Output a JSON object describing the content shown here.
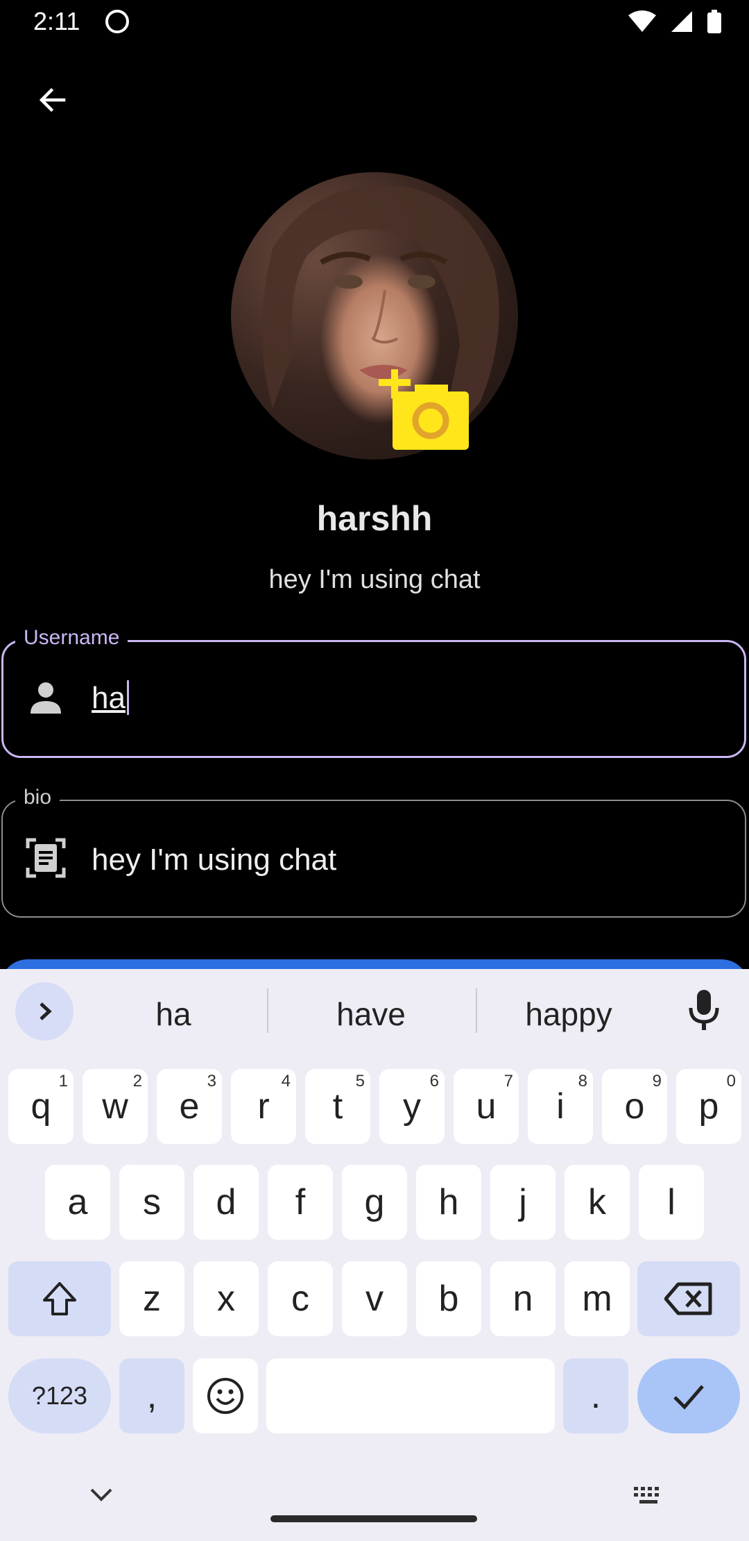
{
  "status_bar": {
    "time": "2:11"
  },
  "profile": {
    "name": "harshh",
    "bio": "hey I'm using chat"
  },
  "fields": {
    "username": {
      "label": "Username",
      "value": "ha"
    },
    "bio": {
      "label": "bio",
      "value": "hey I'm using chat"
    }
  },
  "keyboard": {
    "suggestions": [
      "ha",
      "have",
      "happy"
    ],
    "row1": [
      {
        "k": "q",
        "s": "1"
      },
      {
        "k": "w",
        "s": "2"
      },
      {
        "k": "e",
        "s": "3"
      },
      {
        "k": "r",
        "s": "4"
      },
      {
        "k": "t",
        "s": "5"
      },
      {
        "k": "y",
        "s": "6"
      },
      {
        "k": "u",
        "s": "7"
      },
      {
        "k": "i",
        "s": "8"
      },
      {
        "k": "o",
        "s": "9"
      },
      {
        "k": "p",
        "s": "0"
      }
    ],
    "row2": [
      "a",
      "s",
      "d",
      "f",
      "g",
      "h",
      "j",
      "k",
      "l"
    ],
    "row3": [
      "z",
      "x",
      "c",
      "v",
      "b",
      "n",
      "m"
    ],
    "symbols_label": "?123",
    "comma": ",",
    "period": "."
  },
  "colors": {
    "field_focus": "#cbb7f3",
    "keyboard_bg": "#eeedf5",
    "enter_key": "#a9c4f7",
    "accent_button": "#2d6fe0",
    "camera_badge": "#ffe61a"
  }
}
